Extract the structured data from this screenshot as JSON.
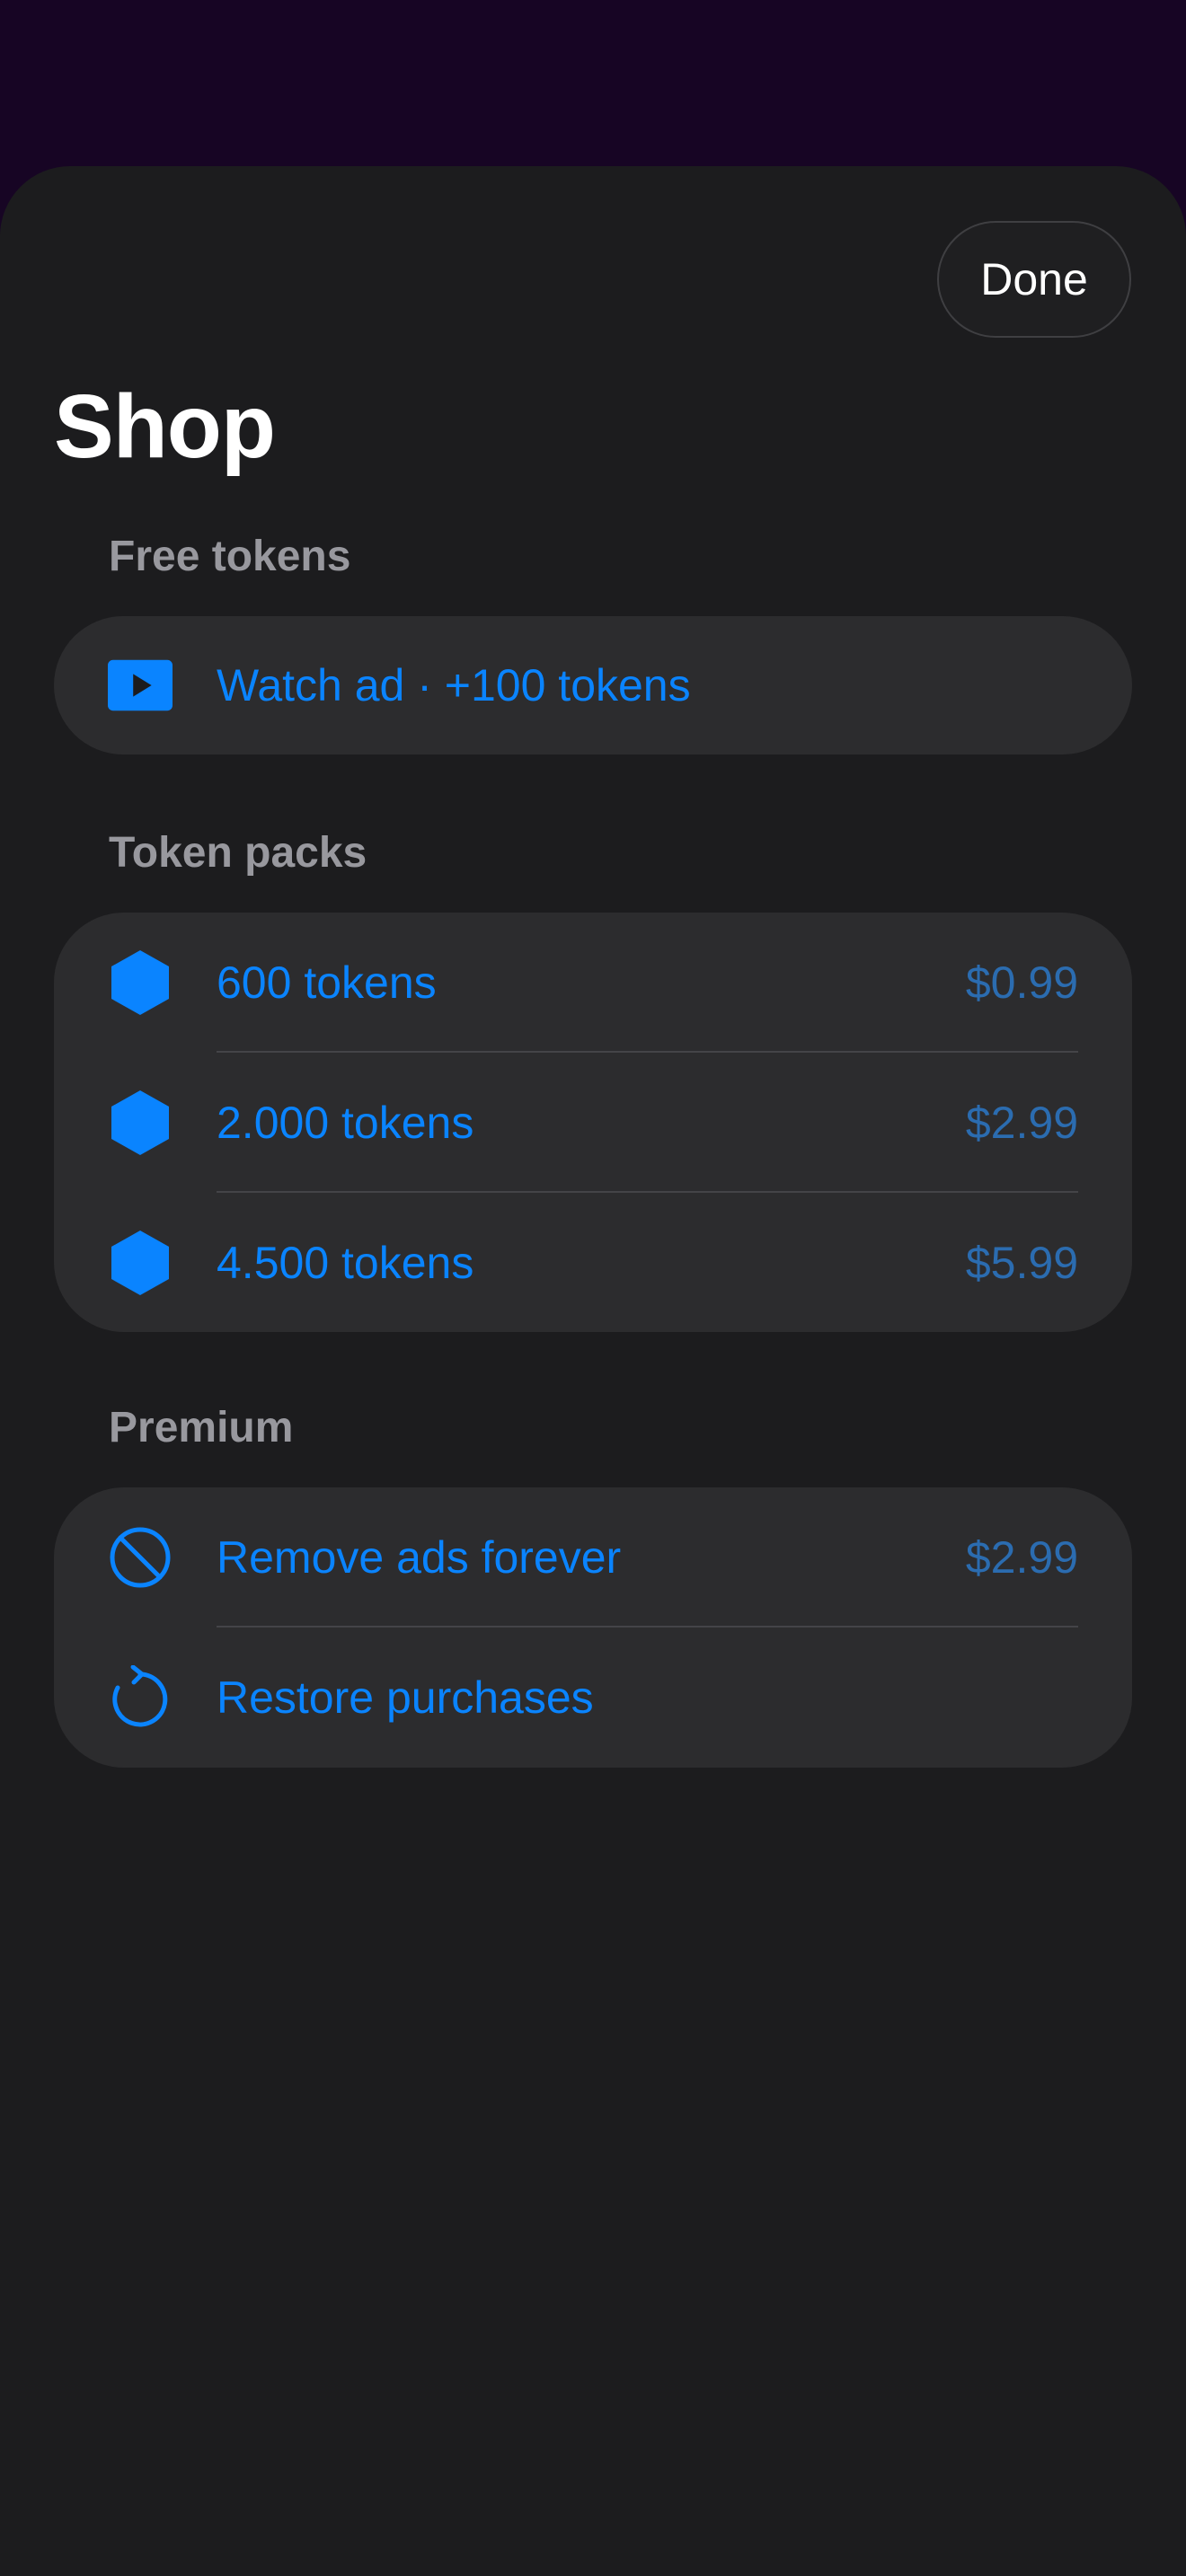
{
  "colors": {
    "accent": "#0a84ff",
    "price": "#2b6cb0",
    "sheet_background": "#1c1c1e",
    "group_background": "#2c2c2e",
    "section_header": "#98989e",
    "backdrop": "#170524"
  },
  "header": {
    "done_label": "Done",
    "title": "Shop"
  },
  "free_tokens": {
    "header": "Free tokens",
    "items": [
      {
        "icon": "play-rectangle-icon",
        "label": "Watch ad · +100 tokens"
      }
    ]
  },
  "token_packs": {
    "header": "Token packs",
    "items": [
      {
        "icon": "hexagon-icon",
        "label": "600 tokens",
        "price": "$0.99"
      },
      {
        "icon": "hexagon-icon",
        "label": "2.000 tokens",
        "price": "$2.99"
      },
      {
        "icon": "hexagon-icon",
        "label": "4.500 tokens",
        "price": "$5.99"
      }
    ]
  },
  "premium": {
    "header": "Premium",
    "items": [
      {
        "icon": "prohibited-icon",
        "label": "Remove ads forever",
        "price": "$2.99"
      },
      {
        "icon": "restore-arrow-icon",
        "label": "Restore purchases"
      }
    ]
  }
}
